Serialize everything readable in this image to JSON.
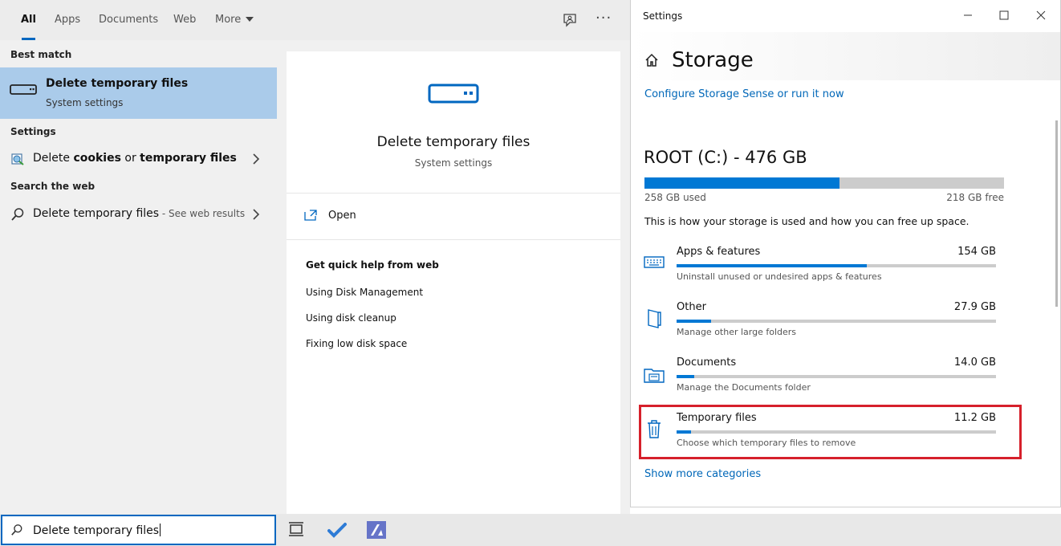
{
  "search": {
    "tabs": [
      {
        "label": "All",
        "active": true
      },
      {
        "label": "Apps"
      },
      {
        "label": "Documents"
      },
      {
        "label": "Web"
      },
      {
        "label": "More"
      }
    ],
    "more_icon": "ellipsis-icon",
    "feedback_icon": "feedback-icon",
    "best_match_heading": "Best match",
    "best_match": {
      "title": "Delete temporary files",
      "subtitle": "System settings",
      "icon": "drive-icon"
    },
    "settings_heading": "Settings",
    "settings_result": {
      "pre": "Delete ",
      "bold1": "cookies",
      "mid": " or ",
      "bold2": "temporary files",
      "icon": "internet-options-icon"
    },
    "web_heading": "Search the web",
    "web_result": {
      "label": "Delete temporary files",
      "suffix": " - See web results",
      "icon": "search-icon"
    },
    "detail": {
      "title": "Delete temporary files",
      "subtitle": "System settings",
      "open_label": "Open",
      "help_heading": "Get quick help from web",
      "help_links": [
        "Using Disk Management",
        "Using disk cleanup",
        "Fixing low disk space"
      ]
    },
    "box_value": "Delete temporary files"
  },
  "taskbar": {
    "icons": [
      "task-view-icon",
      "todo-icon",
      "app-icon"
    ]
  },
  "settings": {
    "window_title": "Settings",
    "page_title": "Storage",
    "sense_link": "Configure Storage Sense or run it now",
    "drive": {
      "title": "ROOT (C:) - 476 GB",
      "used_label": "258 GB used",
      "free_label": "218 GB free",
      "used_fraction": 0.542
    },
    "description": "This is how your storage is used and how you can free up space.",
    "categories": [
      {
        "name": "Apps & features",
        "size": "154 GB",
        "hint": "Uninstall unused or undesired apps & features",
        "fraction": 0.595,
        "icon": "apps-features-icon"
      },
      {
        "name": "Other",
        "size": "27.9 GB",
        "hint": "Manage other large folders",
        "fraction": 0.107,
        "icon": "other-icon"
      },
      {
        "name": "Documents",
        "size": "14.0 GB",
        "hint": "Manage the Documents folder",
        "fraction": 0.055,
        "icon": "documents-icon"
      },
      {
        "name": "Temporary files",
        "size": "11.2 GB",
        "hint": "Choose which temporary files to remove",
        "fraction": 0.044,
        "icon": "trash-icon"
      }
    ],
    "more_link": "Show more categories",
    "colors": {
      "accent": "#0078d4",
      "link": "#0067b8",
      "highlight": "#d6202b",
      "selection": "#aacbea"
    }
  }
}
